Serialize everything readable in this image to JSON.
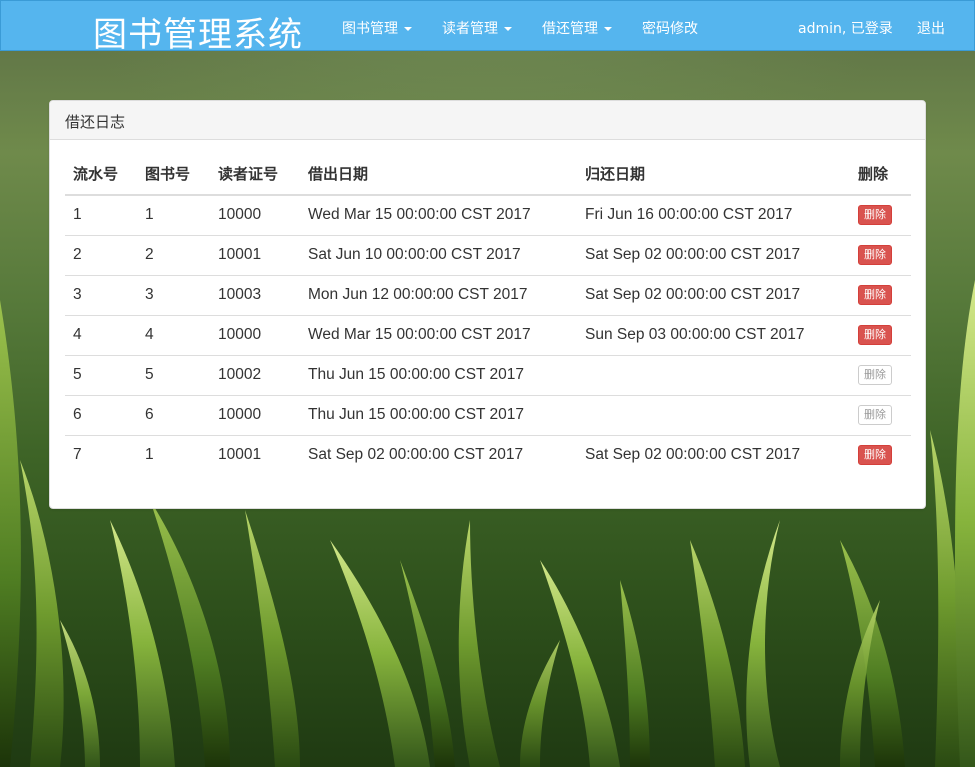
{
  "navbar": {
    "brand": "图书管理系统",
    "menu": [
      {
        "label": "图书管理",
        "dropdown": true
      },
      {
        "label": "读者管理",
        "dropdown": true
      },
      {
        "label": "借还管理",
        "dropdown": true
      },
      {
        "label": "密码修改",
        "dropdown": false
      }
    ],
    "user_status": "admin, 已登录",
    "logout": "退出"
  },
  "panel": {
    "title": "借还日志",
    "columns": [
      "流水号",
      "图书号",
      "读者证号",
      "借出日期",
      "归还日期",
      "删除"
    ],
    "rows": [
      {
        "serial": "1",
        "book_id": "1",
        "reader_id": "10000",
        "lend_date": "Wed Mar 15 00:00:00 CST 2017",
        "return_date": "Fri Jun 16 00:00:00 CST 2017",
        "delete_label": "删除",
        "delete_enabled": true
      },
      {
        "serial": "2",
        "book_id": "2",
        "reader_id": "10001",
        "lend_date": "Sat Jun 10 00:00:00 CST 2017",
        "return_date": "Sat Sep 02 00:00:00 CST 2017",
        "delete_label": "删除",
        "delete_enabled": true
      },
      {
        "serial": "3",
        "book_id": "3",
        "reader_id": "10003",
        "lend_date": "Mon Jun 12 00:00:00 CST 2017",
        "return_date": "Sat Sep 02 00:00:00 CST 2017",
        "delete_label": "删除",
        "delete_enabled": true
      },
      {
        "serial": "4",
        "book_id": "4",
        "reader_id": "10000",
        "lend_date": "Wed Mar 15 00:00:00 CST 2017",
        "return_date": "Sun Sep 03 00:00:00 CST 2017",
        "delete_label": "删除",
        "delete_enabled": true
      },
      {
        "serial": "5",
        "book_id": "5",
        "reader_id": "10002",
        "lend_date": "Thu Jun 15 00:00:00 CST 2017",
        "return_date": "",
        "delete_label": "删除",
        "delete_enabled": false
      },
      {
        "serial": "6",
        "book_id": "6",
        "reader_id": "10000",
        "lend_date": "Thu Jun 15 00:00:00 CST 2017",
        "return_date": "",
        "delete_label": "删除",
        "delete_enabled": false
      },
      {
        "serial": "7",
        "book_id": "1",
        "reader_id": "10001",
        "lend_date": "Sat Sep 02 00:00:00 CST 2017",
        "return_date": "Sat Sep 02 00:00:00 CST 2017",
        "delete_label": "删除",
        "delete_enabled": true
      }
    ]
  },
  "colors": {
    "navbar": "#55b5ee",
    "danger": "#d9534f",
    "panel_heading": "#f5f5f5"
  }
}
